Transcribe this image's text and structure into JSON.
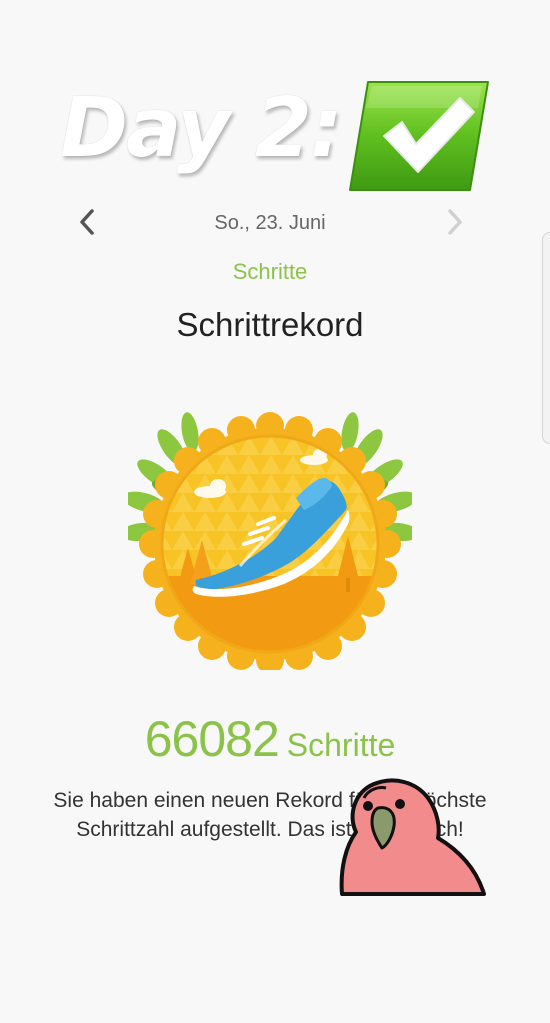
{
  "overlay": {
    "title": "Day 2:",
    "check_icon": "green-checkmark-icon"
  },
  "nav": {
    "date": "So., 23. Juni",
    "prev_icon": "chevron-left-icon",
    "next_icon": "chevron-right-icon"
  },
  "section": {
    "category": "Schritte",
    "heading": "Schrittrekord"
  },
  "badge": {
    "icon": "running-shoe-medal-icon"
  },
  "record": {
    "value": "66082",
    "unit": "Schritte"
  },
  "message": "Sie haben einen neuen Rekord für die höchste Schrittzahl aufgestellt. Das ist fantastisch!",
  "sticker": {
    "icon": "party-parrot-sticker"
  },
  "colors": {
    "accent": "#8bc34a",
    "check_green": "#66bb22",
    "medal_yellow": "#f7c325",
    "shoe_blue": "#42a5e0"
  }
}
